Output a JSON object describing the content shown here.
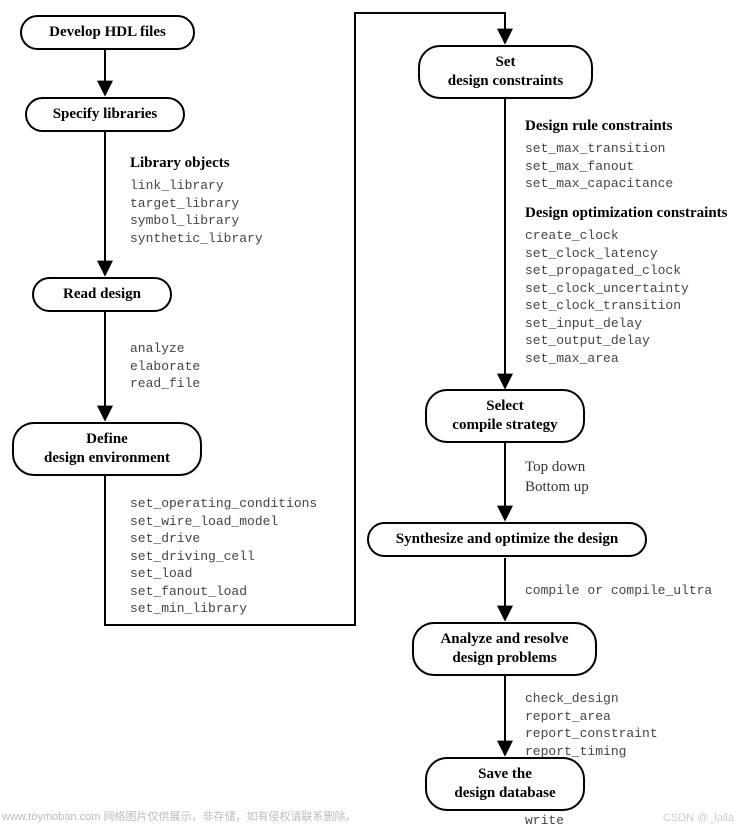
{
  "nodes": {
    "develop": "Develop HDL files",
    "specify": "Specify libraries",
    "read": "Read design",
    "define_l1": "Define",
    "define_l2": "design environment",
    "set_l1": "Set",
    "set_l2": "design constraints",
    "select_l1": "Select",
    "select_l2": "compile strategy",
    "synth": "Synthesize and optimize the design",
    "analyze_l1": "Analyze and resolve",
    "analyze_l2": "design problems",
    "save_l1": "Save the",
    "save_l2": "design database"
  },
  "headings": {
    "library_objects": "Library objects",
    "design_rule": "Design rule constraints",
    "design_opt": "Design optimization constraints"
  },
  "lists": {
    "library_objects": "link_library\ntarget_library\nsymbol_library\nsynthetic_library",
    "read_cmds": "analyze\nelaborate\nread_file",
    "env_cmds": "set_operating_conditions\nset_wire_load_model\nset_drive\nset_driving_cell\nset_load\nset_fanout_load\nset_min_library",
    "drc_cmds": "set_max_transition\nset_max_fanout\nset_max_capacitance",
    "opt_cmds": "create_clock\nset_clock_latency\nset_propagated_clock\nset_clock_uncertainty\nset_clock_transition\nset_input_delay\nset_output_delay\nset_max_area",
    "compile_cmd": "compile or compile_ultra",
    "report_cmds": "check_design\nreport_area\nreport_constraint\nreport_timing",
    "write_cmd": "write"
  },
  "captions": {
    "strategy": "Top down\nBottom up"
  },
  "meta": {
    "watermark": "www.toymoban.com 网络图片仅供展示，非存储，如有侵权请联系删除。",
    "csdn": "CSDN @_lalla"
  }
}
